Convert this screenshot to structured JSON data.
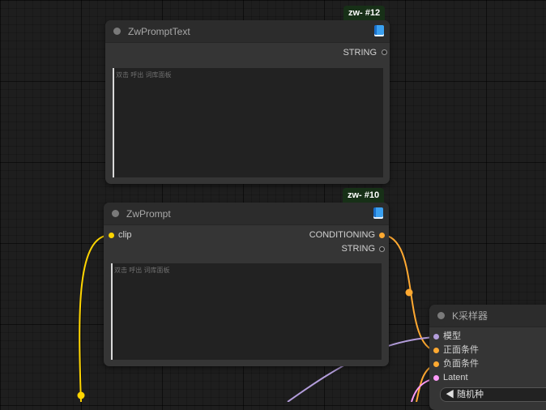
{
  "nodes": {
    "prompt_text": {
      "badge": "zw- #12",
      "title": "ZwPromptText",
      "output_string": "STRING",
      "textarea_hint": "双击 呼出 词库面板"
    },
    "prompt": {
      "badge": "zw- #10",
      "title": "ZwPrompt",
      "input_clip": "clip",
      "output_conditioning": "CONDITIONING",
      "output_string": "STRING",
      "textarea_hint": "双击 呼出 词库面板"
    },
    "ksampler": {
      "title": "K采样器",
      "input_model": "模型",
      "input_positive": "正面条件",
      "input_negative": "负面条件",
      "input_latent": "Latent",
      "widget_seed": "◀ 随机种"
    }
  },
  "colors": {
    "clip": "#ffd500",
    "conditioning": "#ffa931",
    "model": "#b39ddb",
    "latent": "#ff9cf9",
    "string": "#9a9a9a"
  },
  "icons": {
    "book": "book-icon",
    "collapse": "collapse-dot-icon"
  }
}
